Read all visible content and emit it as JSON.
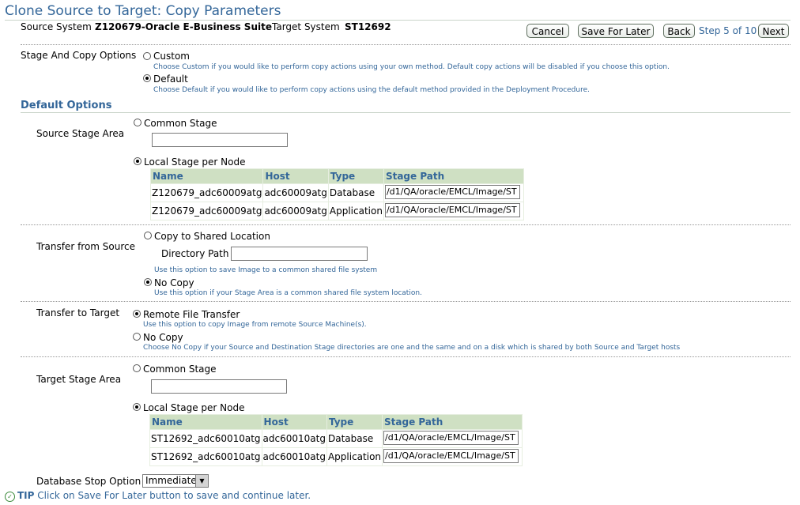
{
  "page": {
    "title": "Clone Source to Target: Copy Parameters",
    "source_system_label": "Source System",
    "source_system_value": "Z120679-Oracle E-Business Suite",
    "target_system_label": "Target System",
    "target_system_value": "ST12692"
  },
  "nav": {
    "cancel": "Cancel",
    "save_for_later": "Save For Later",
    "back": "Back",
    "step": "Step 5 of 10",
    "next": "Next"
  },
  "stage_copy": {
    "label": "Stage And Copy Options",
    "custom": "Custom",
    "custom_help": "Choose Custom if you would like to perform copy actions using your own method. Default copy actions will be disabled if you choose this option.",
    "default": "Default",
    "default_help": "Choose Default if you would like to perform copy actions using the default method provided in the Deployment Procedure.",
    "selected": "default"
  },
  "default_options": {
    "heading": "Default Options"
  },
  "source_stage": {
    "label": "Source Stage Area",
    "common": "Common Stage",
    "common_value": "",
    "local": "Local Stage per Node",
    "selected": "local",
    "columns": [
      "Name",
      "Host",
      "Type",
      "Stage Path"
    ],
    "rows": [
      {
        "name": "Z120679_adc60009atg",
        "host": "adc60009atg",
        "type": "Database",
        "path": "/d1/QA/oracle/EMCL/Image/ST"
      },
      {
        "name": "Z120679_adc60009atg",
        "host": "adc60009atg",
        "type": "Application",
        "path": "/d1/QA/oracle/EMCL/Image/ST"
      }
    ]
  },
  "transfer_source": {
    "label": "Transfer from Source",
    "copy_shared": "Copy to Shared Location",
    "dir_label": "Directory Path",
    "dir_value": "",
    "copy_help": "Use this option to save Image to a common shared file system",
    "no_copy": "No Copy",
    "no_copy_help": "Use this option if your Stage Area is a common shared file system location.",
    "selected": "no_copy"
  },
  "transfer_target": {
    "label": "Transfer to Target",
    "remote": "Remote File Transfer",
    "remote_help": "Use this option to copy Image from remote Source Machine(s).",
    "no_copy": "No Copy",
    "no_copy_help": "Choose No Copy if your Source and Destination Stage directories are one and the same and on a disk which is shared by both Source and Target hosts",
    "selected": "remote"
  },
  "target_stage": {
    "label": "Target Stage Area",
    "common": "Common Stage",
    "common_value": "",
    "local": "Local Stage per Node",
    "selected": "local",
    "columns": [
      "Name",
      "Host",
      "Type",
      "Stage Path"
    ],
    "rows": [
      {
        "name": "ST12692_adc60010atg",
        "host": "adc60010atg",
        "type": "Database",
        "path": "/d1/QA/oracle/EMCL/Image/ST"
      },
      {
        "name": "ST12692_adc60010atg",
        "host": "adc60010atg",
        "type": "Application",
        "path": "/d1/QA/oracle/EMCL/Image/ST"
      }
    ]
  },
  "db_stop": {
    "label": "Database Stop Option",
    "value": "Immediate"
  },
  "tip": {
    "prefix": "TIP",
    "text": "Click on Save For Later button to save and continue later."
  }
}
